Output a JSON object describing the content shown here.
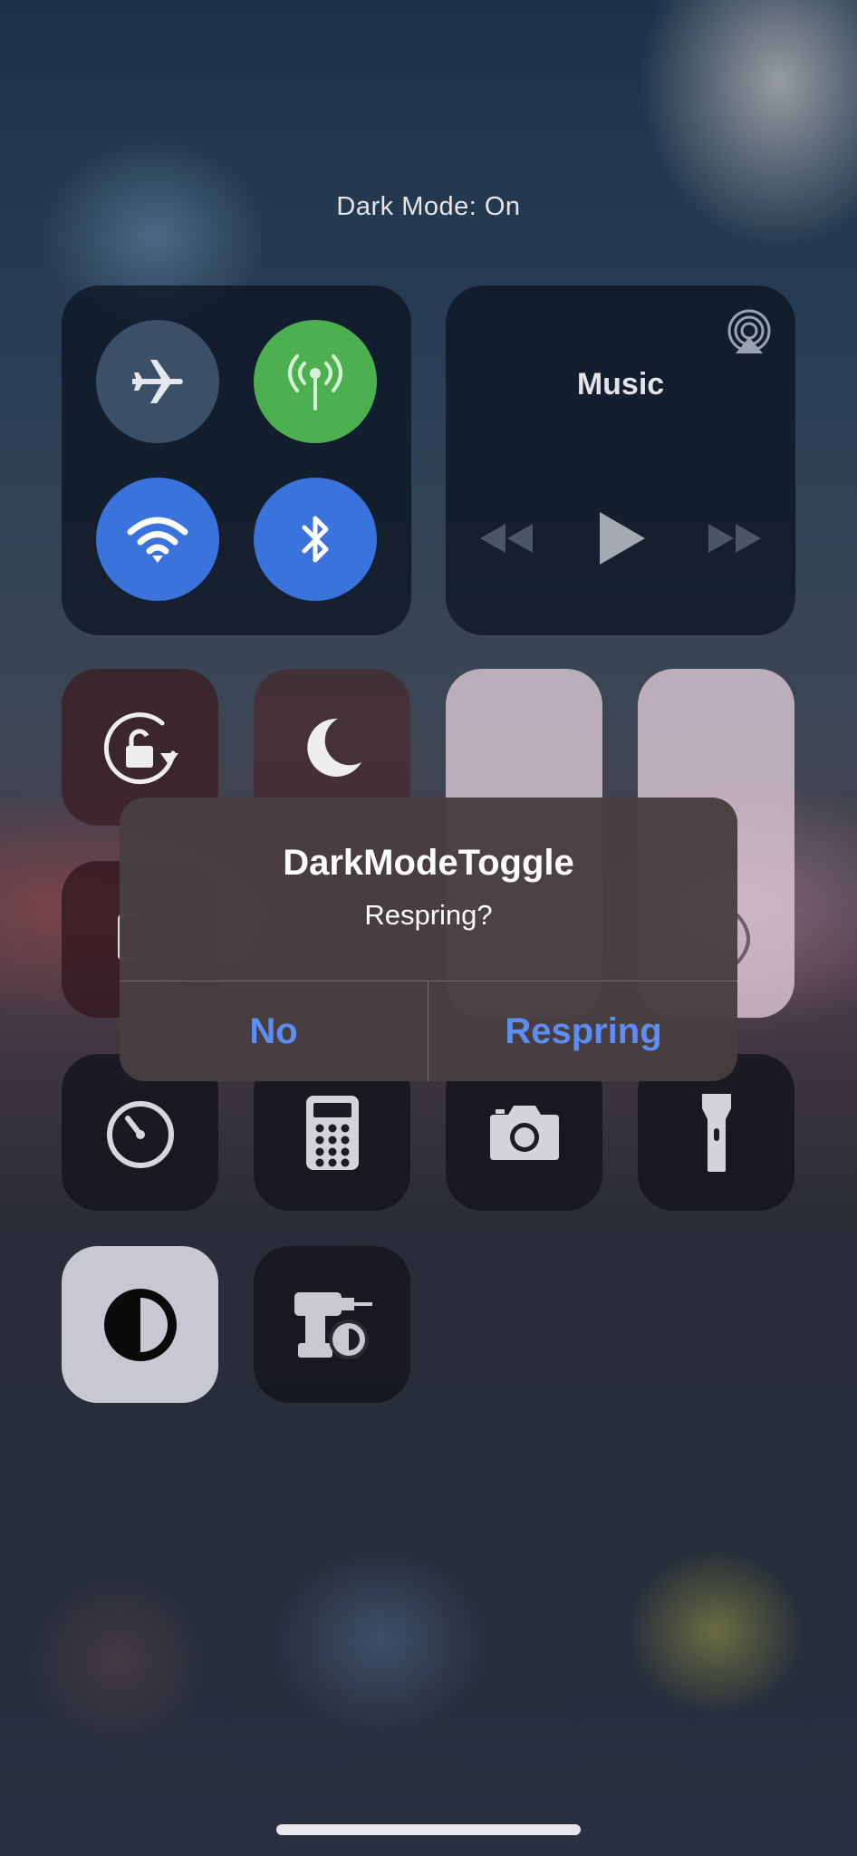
{
  "status": {
    "dark_mode_text": "Dark Mode: On"
  },
  "music": {
    "title": "Music"
  },
  "alert": {
    "title": "DarkModeToggle",
    "message": "Respring?",
    "buttons": {
      "no": "No",
      "respring": "Respring"
    }
  },
  "colors": {
    "cellular_on": "#4caf50",
    "wifi_on": "#3a73dc",
    "bluetooth_on": "#3a73dc",
    "airplane_off": "#3b4f66",
    "alert_button": "#5b8ef0",
    "invert_tile": "#c8c8d2"
  },
  "icons": {
    "connectivity": [
      "airplane-icon",
      "cellular-antenna-icon",
      "wifi-icon",
      "bluetooth-icon"
    ],
    "media": [
      "airplay-icon",
      "previous-track-icon",
      "play-icon",
      "next-track-icon"
    ],
    "controls": [
      "rotation-lock-icon",
      "moon-icon",
      "timer-icon",
      "calculator-icon",
      "camera-icon",
      "flashlight-icon",
      "invert-colors-icon",
      "drill-tool-icon"
    ]
  }
}
